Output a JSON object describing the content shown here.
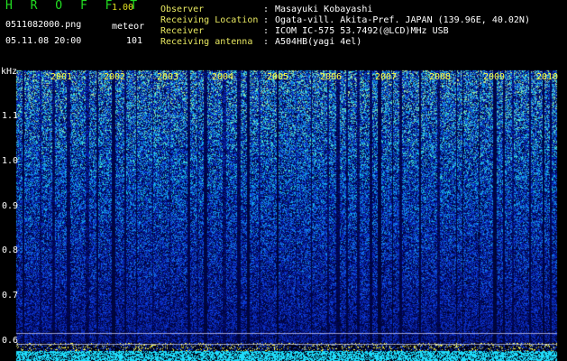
{
  "header": {
    "app_name": "H R O F F T",
    "version": "1.00",
    "file_name": "0511082000.png",
    "mode": "meteor",
    "date_time": "05.11.08 20:00",
    "count": "101"
  },
  "station_info": [
    {
      "label": "Observer",
      "value": "Masayuki Kobayashi"
    },
    {
      "label": "Receiving Location",
      "value": "Ogata-vill. Akita-Pref. JAPAN (139.96E, 40.02N)"
    },
    {
      "label": "Receiver",
      "value": "ICOM IC-575 53.7492(@LCD)MHz USB"
    },
    {
      "label": "Receiving antenna",
      "value": "A504HB(yagi 4el)"
    }
  ],
  "spectrogram": {
    "unit": "kHz",
    "freq_ticks": [
      "1.1",
      "1.0",
      "0.9",
      "0.8",
      "0.7",
      "0.6"
    ],
    "time_ticks": [
      "2001",
      "2002",
      "2003",
      "2004",
      "2005",
      "2006",
      "2007",
      "2008",
      "2009",
      "2010"
    ],
    "colors": {
      "background": "#000000",
      "low": "#0a1e8c",
      "mid": "#1e50ff",
      "high": "#32e6dc",
      "peak": "#ffff60",
      "baseline": "#22e6ff"
    }
  }
}
